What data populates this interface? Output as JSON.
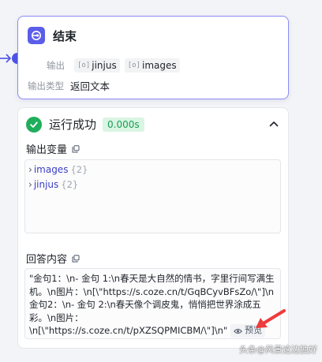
{
  "node": {
    "title": "结束",
    "icon": "end-node-icon",
    "accent_color": "#5b5ee8",
    "output_label": "输出",
    "output_vars": [
      {
        "type_icon": "[o]",
        "name": "jinjus"
      },
      {
        "type_icon": "[o]",
        "name": "images"
      }
    ],
    "output_type_label": "输出类型",
    "output_type_value": "返回文本"
  },
  "result": {
    "status_text": "运行成功",
    "duration": "0.000s",
    "status_color": "#1fae5b",
    "output_vars_title": "输出变量",
    "vars": [
      {
        "key": "images",
        "count": "{2}"
      },
      {
        "key": "jinjus",
        "count": "{2}"
      }
    ],
    "answer_title": "回答内容",
    "answer_lines": [
      "\"金句1：\\n- 金句 1:\\n春天是大自然的情书，字里行间写满生",
      "机。\\n图片：\\n[\\\"https://s.coze.cn/t/GqBCyvBFsZo/\\\"]\\n",
      "金句2：\\n- 金句 2:\\n春天像个调皮鬼，悄悄把世界涂成五",
      "彩。\\n图片：",
      "\\n[\\\"https://s.coze.cn/t/pXZSQPMICBM/\\\"]\\n\""
    ],
    "preview_label": "预览"
  },
  "watermark": "头条@风景这边独好"
}
